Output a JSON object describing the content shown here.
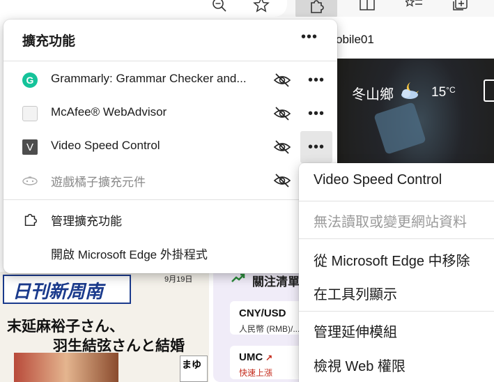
{
  "browser_toolbar": {
    "icons": [
      "search-icon",
      "favorite-star-icon",
      "extensions-puzzle-icon",
      "split-screen-icon",
      "favorites-list-icon",
      "collections-icon"
    ]
  },
  "page": {
    "tab_title": "obile01",
    "weather": {
      "location": "冬山鄉",
      "temperature": "15",
      "unit": "°C"
    },
    "newspaper": {
      "logo": "日刊新周南",
      "date": "9月19日",
      "headline_1": "末延麻裕子さん、",
      "headline_2": "羽生結弦さんと結婚",
      "side_text": "まゆ"
    },
    "watchlist": {
      "title": "關注清單",
      "stocks": [
        {
          "symbol": "CNY/USD",
          "subtitle": "人民幣 (RMB)/..."
        },
        {
          "symbol": "UMC",
          "subtitle": "快速上漲"
        }
      ]
    }
  },
  "extensions_panel": {
    "title": "擴充功能",
    "more_glyph": "•••",
    "items": [
      {
        "name": "Grammarly: Grammar Checker and...",
        "icon_letter": "G",
        "dim": false
      },
      {
        "name": "McAfee® WebAdvisor",
        "icon_letter": "",
        "dim": false
      },
      {
        "name": "Video Speed Control",
        "icon_letter": "V",
        "dim": false
      },
      {
        "name": "遊戲橘子擴充元件",
        "icon_letter": "",
        "dim": true
      }
    ],
    "manage_label": "管理擴充功能",
    "open_addons_label": "開啟 Microsoft Edge 外掛程式"
  },
  "context_menu": {
    "header": "Video Speed Control",
    "site_access": "無法讀取或變更網站資料",
    "remove": "從 Microsoft Edge 中移除",
    "show_in_toolbar": "在工具列顯示",
    "manage_extension": "管理延伸模組",
    "view_web_permissions": "檢視 Web 權限"
  },
  "colors": {
    "grammarly": "#15c39a",
    "hover_gray": "#e6e6e6",
    "watchlist_bg": "#f0ecf8",
    "rise_red": "#c42b1c"
  }
}
